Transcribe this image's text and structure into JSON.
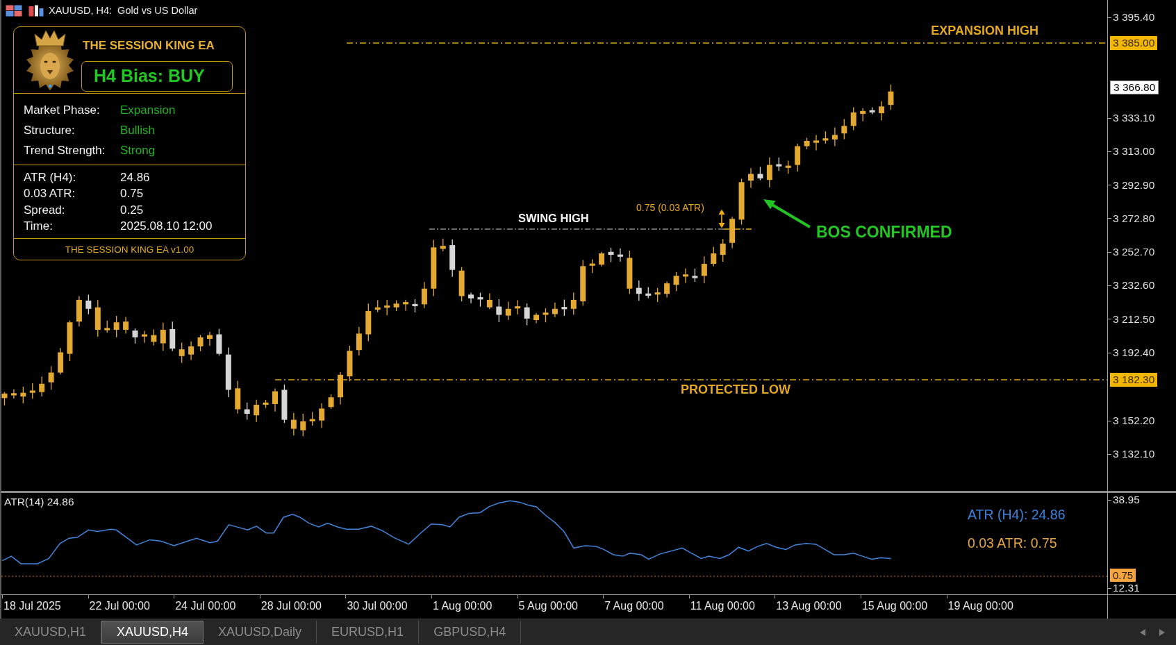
{
  "window": {
    "title": "XAUUSD, H4:  Gold vs US Dollar"
  },
  "info_panel": {
    "title": "THE SESSION KING EA",
    "bias": "H4 Bias: BUY",
    "sections": [
      {
        "kind": "status",
        "rows": [
          {
            "label": "Market Phase:",
            "value": "Expansion"
          },
          {
            "label": "Structure:",
            "value": "Bullish"
          },
          {
            "label": "Trend Strength:",
            "value": "Strong"
          }
        ]
      },
      {
        "kind": "stats",
        "rows": [
          {
            "label": "ATR (H4):",
            "value": "24.86"
          },
          {
            "label": "0.03 ATR:",
            "value": "0.75"
          },
          {
            "label": "Spread:",
            "value": "0.25"
          },
          {
            "label": "Time:",
            "value": "2025.08.10 12:00"
          }
        ]
      }
    ],
    "footer": "THE SESSION KING EA v1.00"
  },
  "price_chart": {
    "levels": [
      {
        "kind": "expansion",
        "label": "EXPANSION HIGH",
        "price": "3 385.00"
      },
      {
        "kind": "protected",
        "label": "PROTECTED LOW",
        "price": "3 182.30"
      }
    ],
    "swing_high": {
      "label": "SWING HIGH",
      "distance": "0.75 (0.03 ATR)"
    },
    "break_of_structure": "BOS CONFIRMED",
    "current_price": "3 366.80",
    "price_axis": [
      "3 395.40",
      "3 333.10",
      "3 313.00",
      "3 292.90",
      "3 272.80",
      "3 252.70",
      "3 232.60",
      "3 212.50",
      "3 192.40",
      "3 152.20",
      "3 132.10"
    ]
  },
  "atr_panel": {
    "title": "ATR(14) 24.86",
    "readouts": [
      {
        "kind": "atr",
        "text": "ATR (H4): 24.86"
      },
      {
        "kind": "fraction",
        "text": "0.03 ATR: 0.75"
      }
    ],
    "scale": [
      "38.95",
      "12.31"
    ],
    "threshold": "0.75"
  },
  "time_axis": [
    "18 Jul 2025",
    "22 Jul 00:00",
    "24 Jul 00:00",
    "28 Jul 00:00",
    "30 Jul 00:00",
    "1 Aug 00:00",
    "5 Aug 00:00",
    "7 Aug 00:00",
    "11 Aug 00:00",
    "13 Aug 00:00",
    "15 Aug 00:00",
    "19 Aug 00:00"
  ],
  "tabs": [
    {
      "label": "XAUUSD,H1",
      "selected": false
    },
    {
      "label": "XAUUSD,H4",
      "selected": true
    },
    {
      "label": "XAUUSD,Daily",
      "selected": false
    },
    {
      "label": "EURUSD,H1",
      "selected": false
    },
    {
      "label": "GBPUSD,H4",
      "selected": false
    }
  ]
}
